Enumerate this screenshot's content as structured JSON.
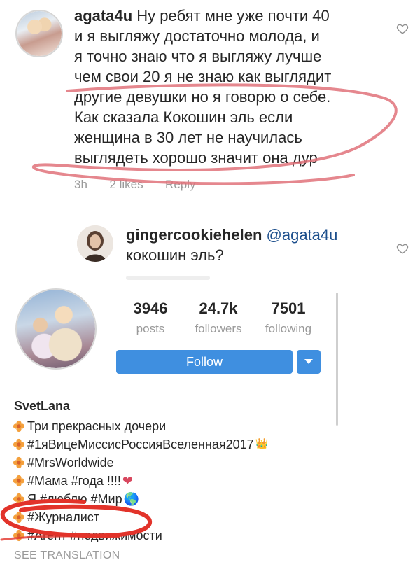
{
  "comment": {
    "username": "agata4u",
    "lines": [
      "Ну ребят мне уже почти 40",
      "и я выгляжу достаточно молода, и",
      "я точно знаю что я выгляжу лучше",
      "чем свои 20 я не знаю как выглядит",
      "другие девушки но я говорю о себе.",
      "Как сказала Кокошин эль если",
      "женщина в 30 лет не научилась",
      "выглядеть хорошо значит она дур"
    ],
    "time": "3h",
    "likes": "2 likes",
    "reply": "Reply"
  },
  "reply_comment": {
    "username": "gingercookiehelen",
    "mention": "@agata4u",
    "text": "кокошин эль?"
  },
  "profile": {
    "stats": [
      {
        "value": "3946",
        "label": "posts"
      },
      {
        "value": "24.7k",
        "label": "followers"
      },
      {
        "value": "7501",
        "label": "following"
      }
    ],
    "follow_label": "Follow",
    "name": "SvetLana",
    "bio": [
      "Три прекрасных дочери",
      "#1яВицеМиссисРоссияВселенная2017",
      "#MrsWorldwide",
      "#Мама #года !!!!",
      "Я #люблю #Мир",
      "#Журналист",
      "#Агент #недвижимости"
    ],
    "bio_emoji": {
      "crown": "👑",
      "heart": "❤",
      "globe": "🌎"
    },
    "see_translation": "SEE TRANSLATION"
  },
  "colors": {
    "follow": "#3f8fe0",
    "annotation": "#e0727a",
    "circle": "#e2332a"
  }
}
